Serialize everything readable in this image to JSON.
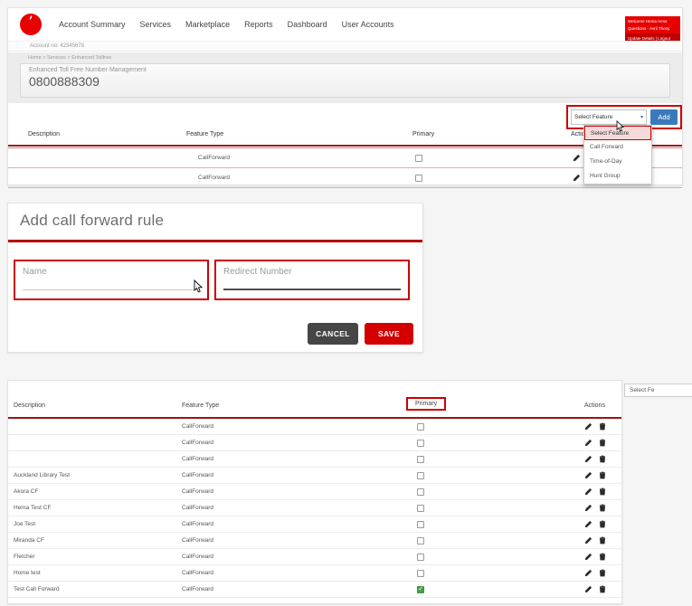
{
  "colors": {
    "brand_red": "#e60000",
    "dark_red": "#b40000",
    "accent_blue": "#3a7abc",
    "save_red": "#d40000",
    "cancel_gray": "#464646",
    "checked_green": "#43a047"
  },
  "glyphs": {
    "caret_down": "▾",
    "speechmark": "’"
  },
  "portal": {
    "nav": [
      "Account Summary",
      "Services",
      "Marketplace",
      "Reports",
      "Dashboard",
      "User Accounts"
    ],
    "welcome": {
      "line1": "Welcome Hema Hess",
      "line2": "Questions - Avril Thony",
      "links": "Update Details | Logout"
    },
    "account_no": "Account no: 42345678",
    "breadcrumb": "Home > Services > Enhanced Tollfree",
    "panel": {
      "title": "Enhanced Toll Free Number Management",
      "number": "0800888309"
    },
    "feature_bar": {
      "select_label": "Select Feature",
      "add_label": "Add"
    },
    "dropdown_options": [
      "Select Feature",
      "Call Forward",
      "Time-of-Day",
      "Hunt Group"
    ],
    "table": {
      "headers": [
        "Description",
        "Feature Type",
        "Primary",
        "Actions"
      ],
      "rows": [
        {
          "description": "",
          "feature_type": "CallForward",
          "primary": false
        },
        {
          "description": "",
          "feature_type": "CallForward",
          "primary": false
        }
      ]
    }
  },
  "modal": {
    "title": "Add call forward rule",
    "name_placeholder": "Name",
    "redirect_placeholder": "Redirect Number",
    "cancel_label": "CANCEL",
    "save_label": "SAVE"
  },
  "features_table": {
    "select_partial": "Select Fe",
    "headers": [
      "Description",
      "Feature Type",
      "Primary",
      "Actions"
    ],
    "rows": [
      {
        "description": "",
        "feature_type": "CallForward",
        "primary": false
      },
      {
        "description": "",
        "feature_type": "CallForward",
        "primary": false
      },
      {
        "description": "",
        "feature_type": "CallForward",
        "primary": false
      },
      {
        "description": "Auckland Library Test",
        "feature_type": "CallForward",
        "primary": false
      },
      {
        "description": "Akora CF",
        "feature_type": "CallForward",
        "primary": false
      },
      {
        "description": "Hema Test CF",
        "feature_type": "CallForward",
        "primary": false
      },
      {
        "description": "Joe Test",
        "feature_type": "CallForward",
        "primary": false
      },
      {
        "description": "Miranda CF",
        "feature_type": "CallForward",
        "primary": false
      },
      {
        "description": "Fletcher",
        "feature_type": "CallForward",
        "primary": false
      },
      {
        "description": "Home test",
        "feature_type": "CallForward",
        "primary": false
      },
      {
        "description": "Test Call Forward",
        "feature_type": "CallForward",
        "primary": true
      }
    ]
  }
}
